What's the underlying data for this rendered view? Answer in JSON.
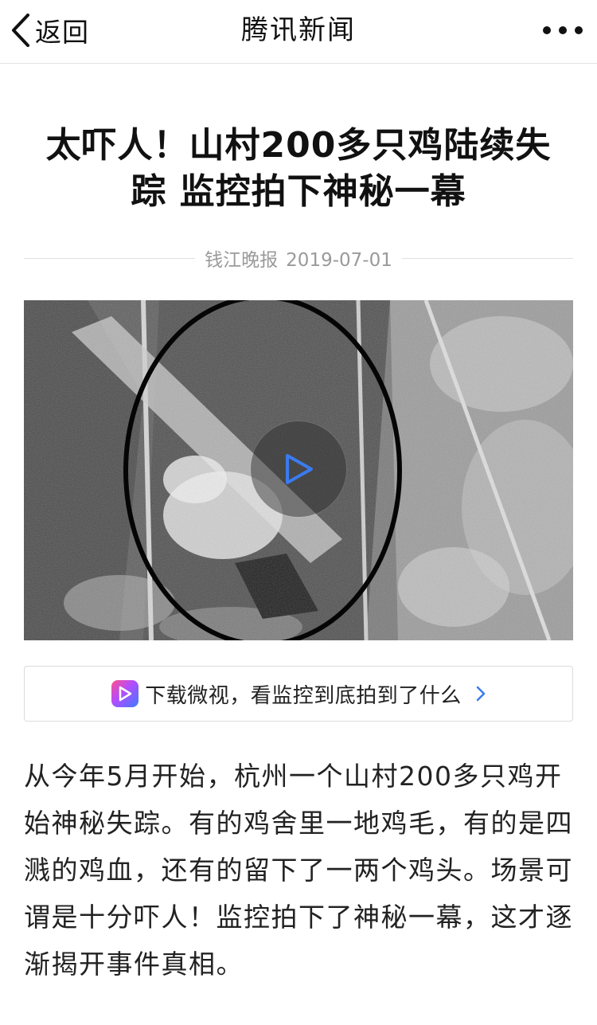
{
  "navbar": {
    "back_label": "返回",
    "title": "腾讯新闻"
  },
  "article": {
    "headline": "太吓人！山村200多只鸡陆续失踪 监控拍下神秘一幕",
    "source": "钱江晚报",
    "date": "2019-07-01",
    "paragraph": "从今年5月开始，杭州一个山村200多只鸡开始神秘失踪。有的鸡舍里一地鸡毛，有的是四溅的鸡血，还有的留下了一两个鸡头。场景可谓是十分吓人！监控拍下了神秘一幕，这才逐渐揭开事件真相。"
  },
  "video": {
    "play_icon": "play-icon"
  },
  "banner": {
    "text": "下载微视，看监控到底拍到了什么",
    "logo_icon": "weishi-logo-icon",
    "arrow_icon": "chevron-right-icon"
  },
  "colors": {
    "accent_blue": "#3a7bef",
    "text": "#222222",
    "meta": "#9a9a9a"
  }
}
